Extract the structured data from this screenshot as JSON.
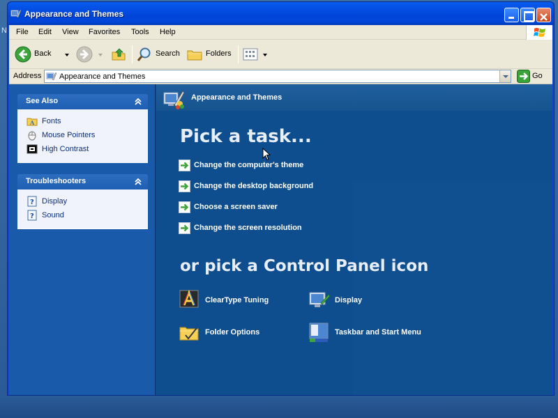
{
  "window": {
    "title": "Appearance and Themes",
    "icon": "control-panel-icon"
  },
  "desktop": {
    "edge_text": "N"
  },
  "menu": {
    "items": [
      "File",
      "Edit",
      "View",
      "Favorites",
      "Tools",
      "Help"
    ]
  },
  "toolbar": {
    "back_label": "Back",
    "search_label": "Search",
    "folders_label": "Folders"
  },
  "address": {
    "label": "Address",
    "value": "Appearance and Themes",
    "go_label": "Go"
  },
  "sidebar": {
    "see_also": {
      "title": "See Also",
      "links": [
        {
          "label": "Fonts",
          "icon": "fonts-folder-icon"
        },
        {
          "label": "Mouse Pointers",
          "icon": "mouse-icon"
        },
        {
          "label": "High Contrast",
          "icon": "high-contrast-icon"
        }
      ]
    },
    "troubleshooters": {
      "title": "Troubleshooters",
      "links": [
        {
          "label": "Display",
          "icon": "help-icon"
        },
        {
          "label": "Sound",
          "icon": "help-icon"
        }
      ]
    }
  },
  "main": {
    "header_title": "Appearance and Themes",
    "pick_task_heading": "Pick a task...",
    "tasks": [
      "Change the computer's theme",
      "Change the desktop background",
      "Choose a screen saver",
      "Change the screen resolution"
    ],
    "pick_icon_heading": "or pick a Control Panel icon",
    "icons": [
      {
        "label": "ClearType Tuning",
        "icon": "cleartype-icon"
      },
      {
        "label": "Display",
        "icon": "display-icon"
      },
      {
        "label": "Folder Options",
        "icon": "folder-options-icon"
      },
      {
        "label": "Taskbar and Start Menu",
        "icon": "taskbar-icon"
      }
    ]
  },
  "colors": {
    "title_bar": "#0046d9",
    "sidebar_bg": "#1a5aab",
    "main_bg": "#0e4e8e",
    "task_arrow": "#3fa43a",
    "close_button": "#c8471a"
  }
}
